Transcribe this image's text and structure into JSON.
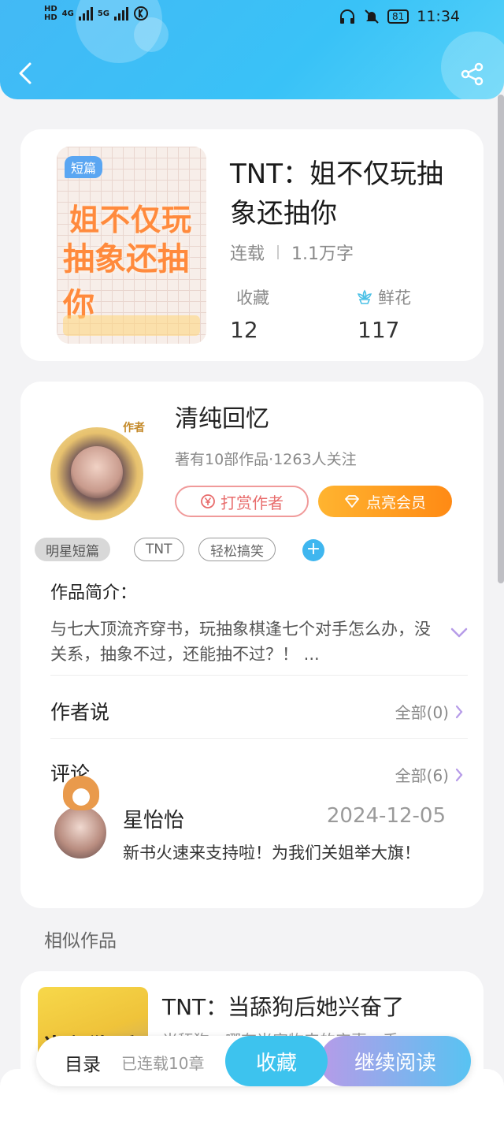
{
  "status_bar": {
    "hd1": "HD",
    "hd2": "HD",
    "net1": "4G",
    "net2": "5G",
    "battery": "81",
    "time": "11:34"
  },
  "book": {
    "cover_badge": "短篇",
    "cover_line1": "姐不仅玩",
    "cover_line2": "抽象还抽你",
    "title": "TNT：姐不仅玩抽象还抽你",
    "status": "连载",
    "word_count": "1.1万字",
    "favorites_label": "收藏",
    "favorites_value": "12",
    "flowers_label": "鲜花",
    "flowers_value": "117"
  },
  "author": {
    "avatar_tag": "作者",
    "name": "清纯回忆",
    "meta": "著有10部作品·1263人关注",
    "tip_label": "打赏作者",
    "vip_label": "点亮会员"
  },
  "tags": [
    "明星短篇",
    "TNT",
    "轻松搞笑"
  ],
  "intro": {
    "title": "作品简介：",
    "text": "与七大顶流齐穿书，玩抽象棋逢七个对手怎么办，没关系，抽象不过，还能抽不过？！ ..."
  },
  "author_says": {
    "title": "作者说",
    "more": "全部(0)"
  },
  "comments": {
    "title": "评论",
    "more": "全部(6)",
    "items": [
      {
        "user": "星怡怡",
        "date": "2024-12-05",
        "text": "新书火速来支持啦！为我们关姐举大旗！"
      }
    ]
  },
  "similar": {
    "title": "相似作品",
    "items": [
      {
        "cover_text": "当舔狗后",
        "title": "TNT：当舔狗后她兴奋了",
        "sub": "当舔狗，哪有当宠物来的实惠，丢"
      }
    ]
  },
  "bottom_bar": {
    "toc": "目录",
    "chapters": "已连载10章",
    "favorite": "收藏",
    "continue": "继续阅读"
  },
  "colors": {
    "header": "#3ebdf6",
    "accent_blue": "#3dc3ee",
    "vip_orange": "#ff8a14",
    "tip_red": "#e86c6c",
    "chevron_purple": "#b69be8"
  }
}
